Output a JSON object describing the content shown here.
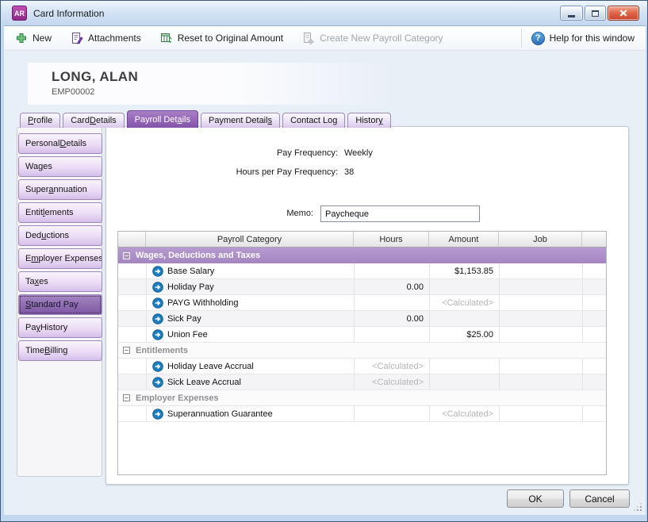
{
  "window": {
    "icon_text": "AR",
    "title": "Card Information"
  },
  "toolbar": {
    "items": [
      {
        "id": "new",
        "label": "New",
        "disabled": false
      },
      {
        "id": "attachments",
        "label": "Attachments",
        "disabled": false
      },
      {
        "id": "reset-original-amount",
        "label": "Reset to Original Amount",
        "disabled": false
      },
      {
        "id": "create-payroll-category",
        "label": "Create New Payroll Category",
        "disabled": true
      }
    ],
    "help_icon": "?",
    "help_label": "Help for this window"
  },
  "employee": {
    "name": "LONG, ALAN",
    "code": "EMP00002"
  },
  "tabs": [
    {
      "id": "profile",
      "pre": "",
      "key": "P",
      "post": "rofile",
      "active": false
    },
    {
      "id": "card-details",
      "pre": "Card ",
      "key": "D",
      "post": "etails",
      "active": false
    },
    {
      "id": "payroll-details",
      "pre": "Payroll Det",
      "key": "a",
      "post": "ils",
      "active": true
    },
    {
      "id": "payment-details",
      "pre": "Payment Detail",
      "key": "s",
      "post": "",
      "active": false
    },
    {
      "id": "contact-log",
      "pre": "Contact Lo",
      "key": "g",
      "post": "",
      "active": false
    },
    {
      "id": "history",
      "pre": "Histor",
      "key": "y",
      "post": "",
      "active": false
    }
  ],
  "sidebar": [
    {
      "id": "personal-details",
      "pre": "Personal ",
      "key": "D",
      "post": "etails",
      "selected": false
    },
    {
      "id": "wages",
      "pre": "Wa",
      "key": "g",
      "post": "es",
      "selected": false
    },
    {
      "id": "superannuation",
      "pre": "Super",
      "key": "a",
      "post": "nnuation",
      "selected": false
    },
    {
      "id": "entitlements",
      "pre": "Entit",
      "key": "l",
      "post": "ements",
      "selected": false
    },
    {
      "id": "deductions",
      "pre": "Ded",
      "key": "u",
      "post": "ctions",
      "selected": false
    },
    {
      "id": "employer-expenses",
      "pre": "E",
      "key": "m",
      "post": "ployer Expenses",
      "selected": false
    },
    {
      "id": "taxes",
      "pre": "Ta",
      "key": "x",
      "post": "es",
      "selected": false
    },
    {
      "id": "standard-pay",
      "pre": "",
      "key": "S",
      "post": "tandard Pay",
      "selected": true
    },
    {
      "id": "pay-history",
      "pre": "Pa",
      "key": "y",
      "post": " History",
      "selected": false
    },
    {
      "id": "time-billing",
      "pre": "Time ",
      "key": "B",
      "post": "illing",
      "selected": false
    }
  ],
  "form": {
    "pay_frequency_label": "Pay Frequency:",
    "pay_frequency_value": "Weekly",
    "hours_label": "Hours per Pay Frequency:",
    "hours_value": "38",
    "memo_label": "Memo:",
    "memo_value": "Paycheque"
  },
  "table": {
    "columns": [
      "",
      "Payroll Category",
      "Hours",
      "Amount",
      "Job",
      ""
    ],
    "groups": [
      {
        "title": "Wages, Deductions and Taxes",
        "variant": "purple",
        "rows": [
          {
            "name": "Base Salary",
            "hours": "",
            "hours_calc": false,
            "amount": "$1,153.85",
            "amount_calc": false,
            "job": ""
          },
          {
            "name": "Holiday Pay",
            "hours": "0.00",
            "hours_calc": false,
            "amount": "",
            "amount_calc": false,
            "job": ""
          },
          {
            "name": "PAYG Withholding",
            "hours": "",
            "hours_calc": false,
            "amount": "<Calculated>",
            "amount_calc": true,
            "job": ""
          },
          {
            "name": "Sick Pay",
            "hours": "0.00",
            "hours_calc": false,
            "amount": "",
            "amount_calc": false,
            "job": ""
          },
          {
            "name": "Union Fee",
            "hours": "",
            "hours_calc": false,
            "amount": "$25.00",
            "amount_calc": false,
            "job": ""
          }
        ]
      },
      {
        "title": "Entitlements",
        "variant": "plain",
        "rows": [
          {
            "name": "Holiday Leave Accrual",
            "hours": "<Calculated>",
            "hours_calc": true,
            "amount": "",
            "amount_calc": false,
            "job": ""
          },
          {
            "name": "Sick Leave Accrual",
            "hours": "<Calculated>",
            "hours_calc": true,
            "amount": "",
            "amount_calc": false,
            "job": ""
          }
        ]
      },
      {
        "title": "Employer Expenses",
        "variant": "plain",
        "rows": [
          {
            "name": "Superannuation Guarantee",
            "hours": "",
            "hours_calc": false,
            "amount": "<Calculated>",
            "amount_calc": true,
            "job": ""
          }
        ]
      }
    ]
  },
  "footer": {
    "ok": "OK",
    "cancel": "Cancel"
  },
  "colors": {
    "accent_purple": "#8253a8",
    "group_header_purple": "#a98cc8",
    "calculated_gray": "#b5b5b8",
    "close_red": "#c7432a",
    "detail_arrow_blue": "#1d7fc1",
    "new_green": "#2f9e44"
  }
}
